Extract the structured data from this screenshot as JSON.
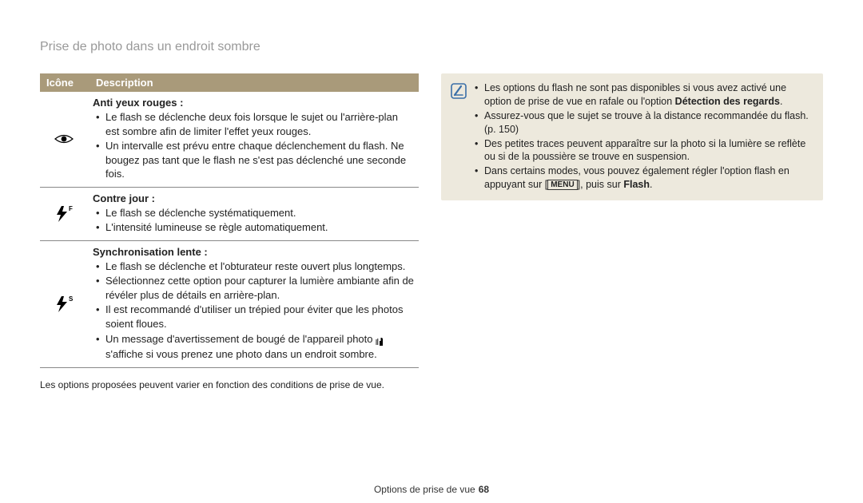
{
  "page_title": "Prise de photo dans un endroit sombre",
  "table": {
    "headers": {
      "icon": "Icône",
      "description": "Description"
    },
    "rows": [
      {
        "title": "Anti yeux rouges :",
        "bullets": [
          "Le flash se déclenche deux fois lorsque le sujet ou l'arrière-plan est sombre afin de limiter l'effet yeux rouges.",
          "Un intervalle est prévu entre chaque déclenchement du flash. Ne bougez pas tant que le flash ne s'est pas déclenché une seconde fois."
        ]
      },
      {
        "title": "Contre jour :",
        "bullets": [
          "Le flash se déclenche systématiquement.",
          "L'intensité lumineuse se règle automatiquement."
        ]
      },
      {
        "title": "Synchronisation lente :",
        "bullets": [
          "Le flash se déclenche et l'obturateur reste ouvert plus longtemps.",
          "Sélectionnez cette option pour capturer la lumière ambiante afin de révéler plus de détails en arrière-plan.",
          "Il est recommandé d'utiliser un trépied pour éviter que les photos soient floues."
        ],
        "last_bullet_a": "Un message d'avertissement de bougé de l'appareil photo ",
        "last_bullet_b": " s'affiche si vous prenez une photo dans un endroit sombre."
      }
    ],
    "footnote": "Les options proposées peuvent varier en fonction des conditions de prise de vue."
  },
  "note_box": {
    "b1a": "Les options du flash ne sont pas disponibles si vous avez activé une option de prise de vue en rafale ou l'option ",
    "b1b": "Détection des regards",
    "b1c": ".",
    "b2": "Assurez-vous que le sujet se trouve à la distance recommandée du flash. (p. 150)",
    "b3": "Des petites traces peuvent apparaître sur la photo si la lumière se reflète ou si de la poussière se trouve en suspension.",
    "b4a": "Dans certains modes, vous pouvez également régler l'option flash en appuyant sur [",
    "b4b": "MENU",
    "b4c": "], puis sur ",
    "b4d": "Flash",
    "b4e": "."
  },
  "footer": {
    "section": "Options de prise de vue",
    "page_number": "68"
  }
}
